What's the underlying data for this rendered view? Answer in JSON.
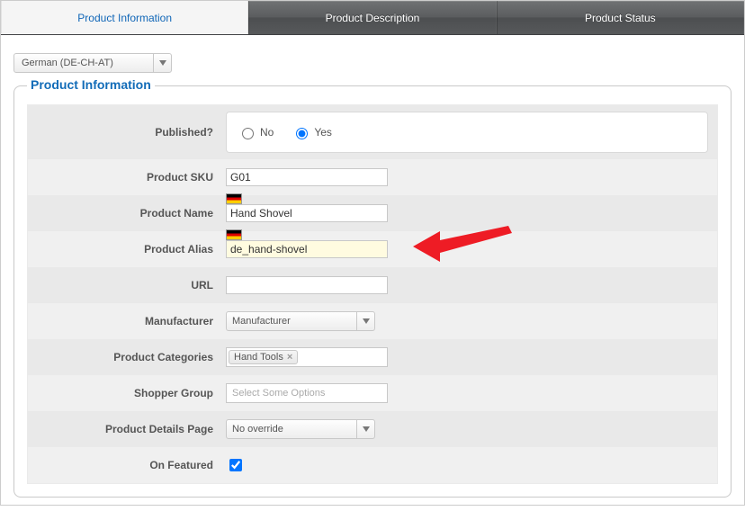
{
  "tabs": {
    "info": "Product Information",
    "desc": "Product Description",
    "status": "Product Status"
  },
  "language": "German (DE-CH-AT)",
  "fieldset_title": "Product Information",
  "labels": {
    "published": "Published?",
    "sku": "Product SKU",
    "name": "Product Name",
    "alias": "Product Alias",
    "url": "URL",
    "manufacturer": "Manufacturer",
    "categories": "Product Categories",
    "shopper_group": "Shopper Group",
    "details_page": "Product Details Page",
    "on_featured": "On Featured"
  },
  "published": {
    "no": "No",
    "yes": "Yes",
    "selected": "yes"
  },
  "values": {
    "sku": "G01",
    "name": "Hand Shovel",
    "alias": "de_hand-shovel",
    "url": ""
  },
  "manufacturer": {
    "selected": "Manufacturer"
  },
  "categories": [
    "Hand Tools"
  ],
  "shopper_group_placeholder": "Select Some Options",
  "details_page": {
    "selected": "No override"
  },
  "on_featured_checked": true
}
